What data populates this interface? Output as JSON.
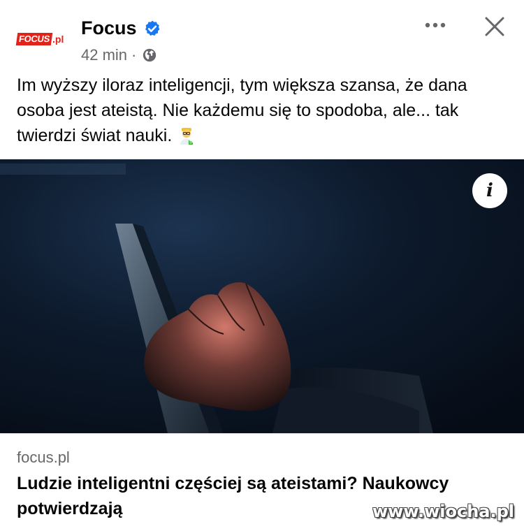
{
  "header": {
    "logo_text": "FOCUS",
    "logo_suffix": ".pl",
    "page_name": "Focus",
    "time": "42 min",
    "separator": "·"
  },
  "post": {
    "text": "Im wyższy iloraz inteligencji, tym większa szansa, że dana osoba jest ateistą. Nie każdemu się to spodoba, ale... tak twierdzi świat nauki."
  },
  "link_preview": {
    "domain": "focus.pl",
    "title": "Ludzie inteligentni częściej są ateistami? Naukowcy potwierdzają",
    "info_label": "i"
  },
  "watermark": "www.wiocha.pl",
  "icons": {
    "verified": "verified-badge-icon",
    "globe": "globe-icon",
    "more": "more-options-icon",
    "close": "close-icon",
    "emoji": "scientist-emoji-icon"
  },
  "colors": {
    "brand_red": "#e2231a",
    "verified_blue": "#1877f2",
    "secondary_text": "#65676b"
  }
}
